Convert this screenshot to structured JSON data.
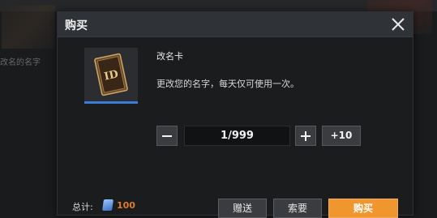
{
  "background": {
    "left_text": "改名的名字"
  },
  "modal": {
    "title": "购买",
    "close_icon": "close-icon",
    "item": {
      "name": "改名卡",
      "description": "更改您的名字，每天仅可使用一次。",
      "thumbnail_icon": "id-card-icon"
    },
    "quantity": {
      "value": "1/999",
      "plus_ten_label": "+10"
    },
    "footer": {
      "total_label": "总计:",
      "currency_icon": "coupon-icon",
      "total_amount": "100",
      "gift_label": "赠送",
      "wish_label": "索要",
      "buy_label": "购买"
    },
    "accent_color": "#f0962e",
    "selected_underline_color": "#3a7bd5"
  }
}
